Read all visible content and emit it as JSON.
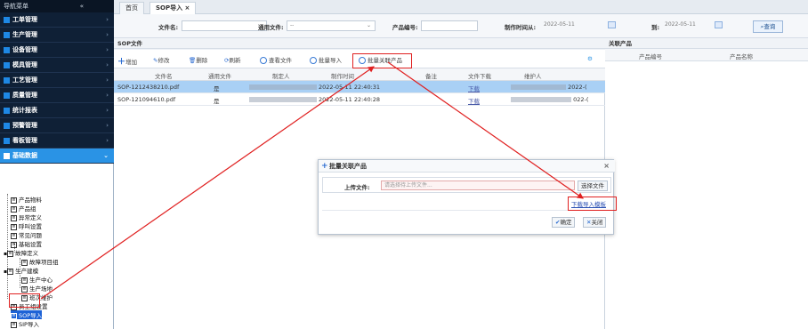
{
  "sidebar": {
    "title": "导航菜单",
    "collapse_icon": "«",
    "items": [
      {
        "label": "工单管理"
      },
      {
        "label": "生产管理"
      },
      {
        "label": "设备管理"
      },
      {
        "label": "模具管理"
      },
      {
        "label": "工艺管理"
      },
      {
        "label": "质量管理"
      },
      {
        "label": "统计报表"
      },
      {
        "label": "预警管理"
      },
      {
        "label": "看板管理"
      },
      {
        "label": "基础数据"
      }
    ],
    "tree": [
      {
        "label": "产品物料"
      },
      {
        "label": "产品组"
      },
      {
        "label": "异常定义"
      },
      {
        "label": "呼叫设置"
      },
      {
        "label": "常见问题"
      },
      {
        "label": "基础设置"
      },
      {
        "label": "故障定义"
      },
      {
        "label": "故障项目组"
      },
      {
        "label": "生产建模"
      },
      {
        "label": "生产中心"
      },
      {
        "label": "生产场地"
      },
      {
        "label": "班次维护"
      },
      {
        "label": "员工组设置"
      },
      {
        "label": "SOP导入"
      },
      {
        "label": "SIP导入"
      }
    ]
  },
  "tabs": [
    {
      "label": "首页"
    },
    {
      "label": "SOP导入 ×"
    }
  ],
  "filter": {
    "file_name_label": "文件名:",
    "general_file_label": "通用文件:",
    "general_file_value": "--",
    "product_code_label": "产品编号:",
    "time_from_label": "制作时间从:",
    "time_from_value": "2022-05-11",
    "time_to_label": "到:",
    "time_to_value": "2022-05-11",
    "query_label": "查询"
  },
  "sop_panel": {
    "title": "SOP文件",
    "toolbar": [
      {
        "label": "增加"
      },
      {
        "label": "修改"
      },
      {
        "label": "删除"
      },
      {
        "label": "刷新"
      },
      {
        "label": "查看文件"
      },
      {
        "label": "批量导入"
      },
      {
        "label": "批量关联产品"
      }
    ],
    "columns": [
      "文件名",
      "通用文件",
      "制定人",
      "制作时间",
      "备注",
      "文件下载",
      "维护人"
    ],
    "rows": [
      {
        "file": "SOP-1212438210.pdf",
        "general": "是",
        "time": "2022-05-11 22:40:31",
        "download": "下载",
        "maint_tail": "2022-("
      },
      {
        "file": "SOP-121094610.pdf",
        "general": "是",
        "time": "2022-05-11 22:40:28",
        "download": "下载",
        "maint_tail": "022-("
      }
    ]
  },
  "related_panel": {
    "title": "关联产品",
    "columns": [
      "产品编号",
      "产品名称"
    ]
  },
  "dialog": {
    "title": "批量关联产品",
    "upload_label": "上传文件:",
    "upload_placeholder": "请选择待上传文件...",
    "choose_label": "选择文件",
    "template_link": "下载导入模板",
    "confirm_label": "确定",
    "close_label": "关闭"
  },
  "colors": {
    "sidebar_bg": "#0d1b2e",
    "active_blue": "#2a93e5",
    "selected_row": "#a9d0f5",
    "annotation_red": "#e02020"
  }
}
